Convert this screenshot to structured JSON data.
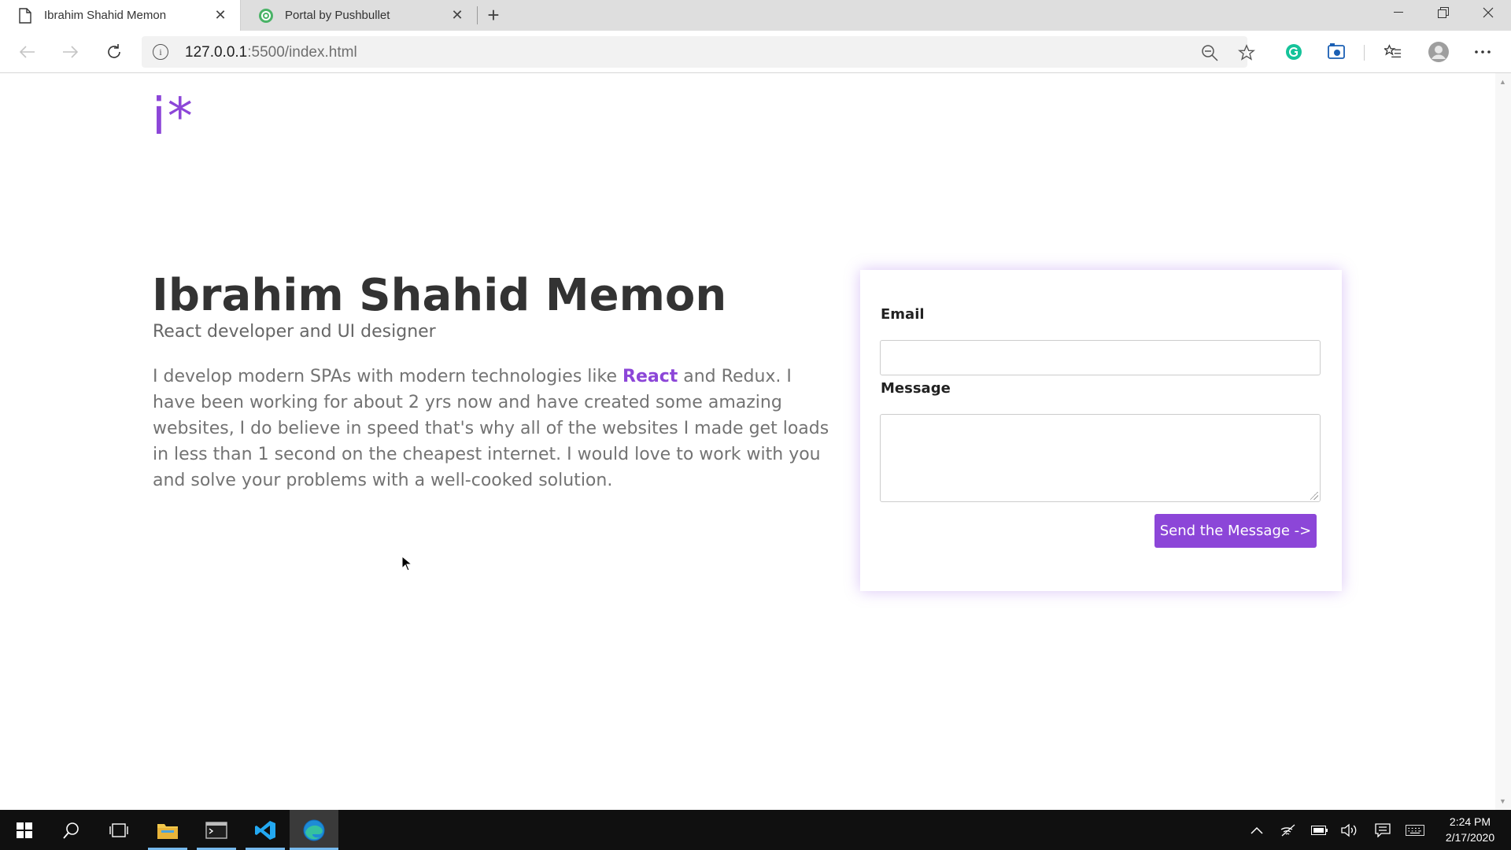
{
  "browser": {
    "tabs": [
      {
        "title": "Ibrahim Shahid Memon",
        "active": true
      },
      {
        "title": "Portal by Pushbullet",
        "active": false
      }
    ],
    "address": {
      "host": "127.0.0.1",
      "path": ":5500/index.html"
    }
  },
  "page": {
    "logo": "i*",
    "name": "Ibrahim Shahid Memon",
    "subtitle": "React developer and UI designer",
    "bio_before": "I develop modern SPAs with modern technologies like ",
    "bio_highlight": "React",
    "bio_after": " and Redux. I have been working for about 2 yrs now and have created some amazing websites, I do believe in speed that's why all of the websites I made get loads in less than 1 second on the cheapest internet. I would love to work with you and solve your problems with a well-cooked solution.",
    "form": {
      "email_label": "Email",
      "email_value": "",
      "message_label": "Message",
      "message_value": "",
      "submit_label": "Send the Message ->"
    }
  },
  "taskbar": {
    "time": "2:24 PM",
    "date": "2/17/2020"
  },
  "colors": {
    "accent": "#8c46d8",
    "heading": "#333333",
    "body_text": "#737373"
  }
}
